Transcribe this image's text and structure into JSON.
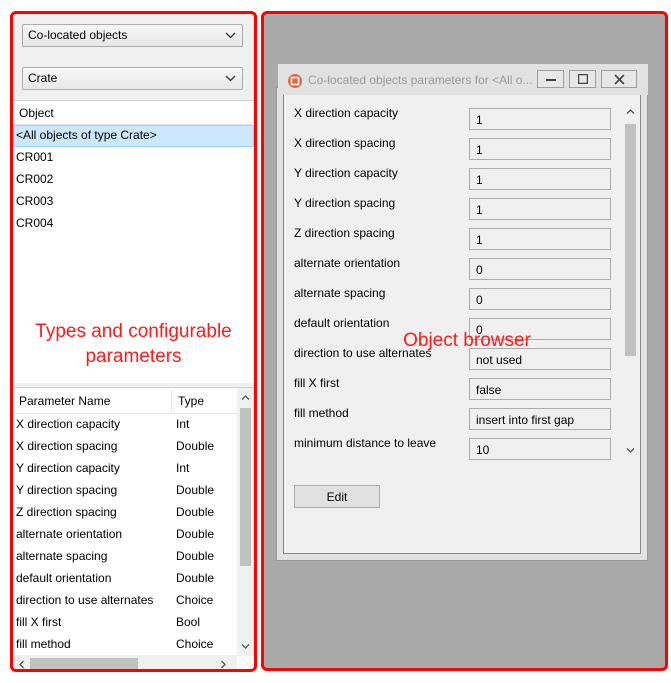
{
  "left": {
    "combo_mode": "Co-located objects",
    "combo_type": "Crate",
    "object_list": {
      "header": "Object",
      "items": [
        "<All objects of type Crate>",
        "CR001",
        "CR002",
        "CR003",
        "CR004"
      ]
    },
    "overlay_label_line1": "Types and configurable",
    "overlay_label_line2": "parameters",
    "param_table": {
      "headers": [
        "Parameter Name",
        "Type"
      ],
      "rows": [
        [
          "X direction capacity",
          "Int"
        ],
        [
          "X direction spacing",
          "Double"
        ],
        [
          "Y direction capacity",
          "Int"
        ],
        [
          "Y direction spacing",
          "Double"
        ],
        [
          "Z direction spacing",
          "Double"
        ],
        [
          "alternate orientation",
          "Double"
        ],
        [
          "alternate spacing",
          "Double"
        ],
        [
          "default orientation",
          "Double"
        ],
        [
          "direction to use alternates",
          "Choice"
        ],
        [
          "fill X first",
          "Bool"
        ],
        [
          "fill method",
          "Choice"
        ]
      ]
    }
  },
  "right": {
    "overlay_label": "Object browser",
    "dialog": {
      "title": "Co-located objects parameters for <All o...",
      "fields": [
        {
          "label": "X direction capacity",
          "value": "1"
        },
        {
          "label": "X direction spacing",
          "value": "1"
        },
        {
          "label": "Y direction capacity",
          "value": "1"
        },
        {
          "label": "Y direction spacing",
          "value": "1"
        },
        {
          "label": "Z direction spacing",
          "value": "1"
        },
        {
          "label": "alternate orientation",
          "value": "0"
        },
        {
          "label": "alternate spacing",
          "value": "0"
        },
        {
          "label": "default orientation",
          "value": "0"
        },
        {
          "label": "direction to use alternates",
          "value": "not used"
        },
        {
          "label": "fill X first",
          "value": "false"
        },
        {
          "label": "fill method",
          "value": "insert into first gap"
        },
        {
          "label": "minimum distance to leave",
          "value": "10"
        }
      ],
      "edit_label": "Edit"
    }
  },
  "colors": {
    "highlight_border": "#ff0000",
    "overlay_text": "#ff1a1a",
    "selection": "#cce8ff",
    "workspace": "#a9a9a9"
  }
}
